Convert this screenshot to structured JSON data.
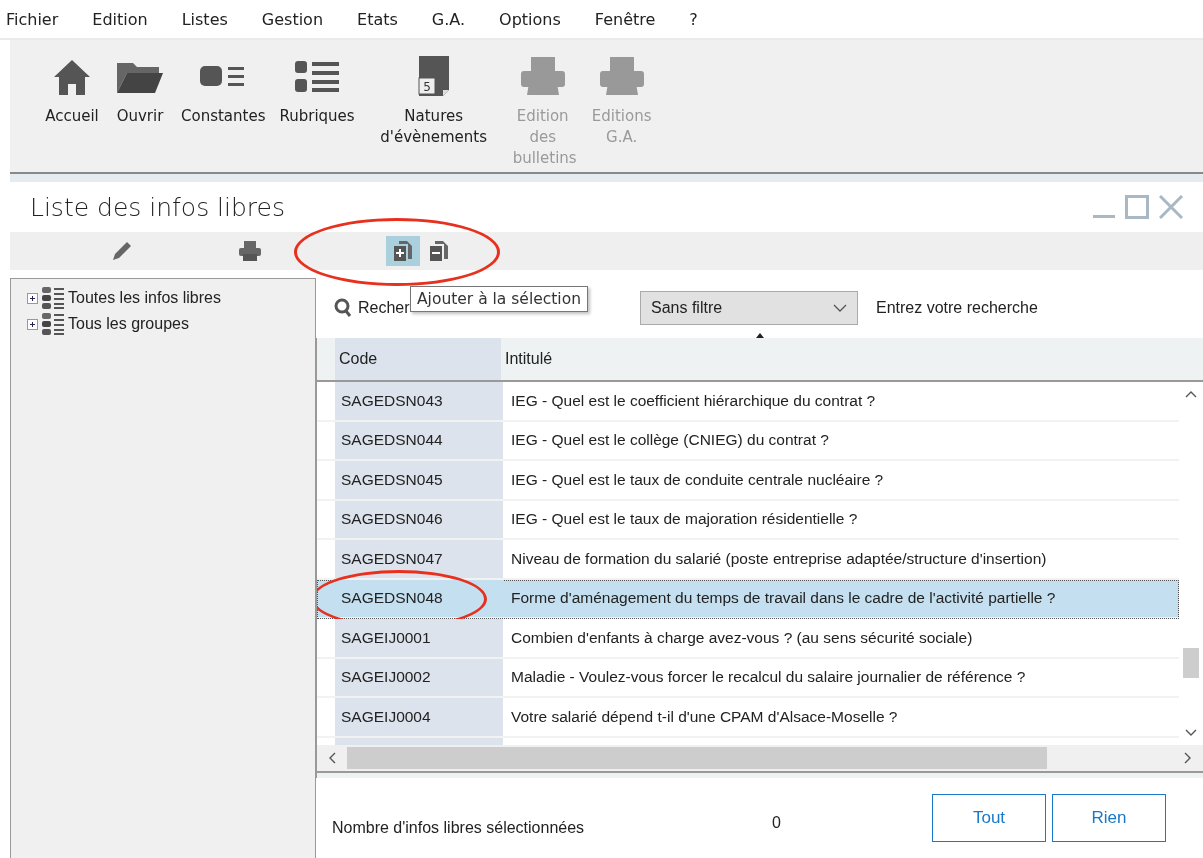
{
  "menu": [
    "Fichier",
    "Edition",
    "Listes",
    "Gestion",
    "Etats",
    "G.A.",
    "Options",
    "Fenêtre",
    "?"
  ],
  "toolbar": [
    {
      "kind": "home",
      "label": "Accueil",
      "disabled": false
    },
    {
      "kind": "folder",
      "label": "Ouvrir",
      "disabled": false
    },
    {
      "kind": "constants",
      "label": "Constantes",
      "disabled": false
    },
    {
      "kind": "list",
      "label": "Rubriques",
      "disabled": false
    },
    {
      "kind": "doc",
      "label": "Natures d'évènements",
      "disabled": false,
      "icon_text": "5"
    },
    {
      "kind": "printer",
      "label": "Edition des bulletins",
      "disabled": true
    },
    {
      "kind": "printer",
      "label": "Editions G.A.",
      "disabled": true
    }
  ],
  "window": {
    "title": "Liste des infos libres"
  },
  "window_toolbar": {
    "tools": [
      {
        "kind": "pencil",
        "highlighted": false
      },
      {
        "kind": "printer",
        "highlighted": false
      }
    ],
    "selection_tools": {
      "circled": true,
      "items": [
        {
          "kind": "add",
          "highlighted": true
        },
        {
          "kind": "remove",
          "highlighted": false
        }
      ]
    },
    "tooltip": "Ajouter à la sélection"
  },
  "tree": [
    {
      "label": "Toutes les infos libres",
      "expanded": false
    },
    {
      "label": "Tous les groupes",
      "expanded": false
    }
  ],
  "search": {
    "label": "Recher",
    "filter": "Sans filtre",
    "placeholder": "Entrez votre recherche"
  },
  "table": {
    "columns": [
      "Code",
      "Intitulé"
    ],
    "rows": [
      {
        "code": "SAGEDSN043",
        "label": "IEG - Quel est le coefficient hiérarchique du contrat ?",
        "selected": false,
        "circled": false
      },
      {
        "code": "SAGEDSN044",
        "label": "IEG - Quel est le collège (CNIEG) du contrat ?",
        "selected": false,
        "circled": false
      },
      {
        "code": "SAGEDSN045",
        "label": "IEG - Quel est le taux de conduite centrale nucléaire ?",
        "selected": false,
        "circled": false
      },
      {
        "code": "SAGEDSN046",
        "label": "IEG - Quel est le taux de majoration résidentielle ?",
        "selected": false,
        "circled": false
      },
      {
        "code": "SAGEDSN047",
        "label": "Niveau de formation du salarié (poste entreprise adaptée/structure d'insertion)",
        "selected": false,
        "circled": false
      },
      {
        "code": "SAGEDSN048",
        "label": "Forme d'aménagement du temps de travail dans le cadre de l'activité partielle ?",
        "selected": true,
        "circled": true
      },
      {
        "code": "SAGEIJ0001",
        "label": "Combien d'enfants à charge avez-vous ? (au sens sécurité sociale)",
        "selected": false,
        "circled": false
      },
      {
        "code": "SAGEIJ0002",
        "label": "Maladie - Voulez-vous forcer le recalcul du salaire journalier de référence ?",
        "selected": false,
        "circled": false
      },
      {
        "code": "SAGEIJ0004",
        "label": "Votre salarié dépend t-il d'une CPAM d'Alsace-Moselle ?",
        "selected": false,
        "circled": false
      }
    ]
  },
  "footer": {
    "label": "Nombre d'infos libres sélectionnées",
    "count": "0",
    "buttons": [
      "Tout",
      "Rien"
    ]
  }
}
